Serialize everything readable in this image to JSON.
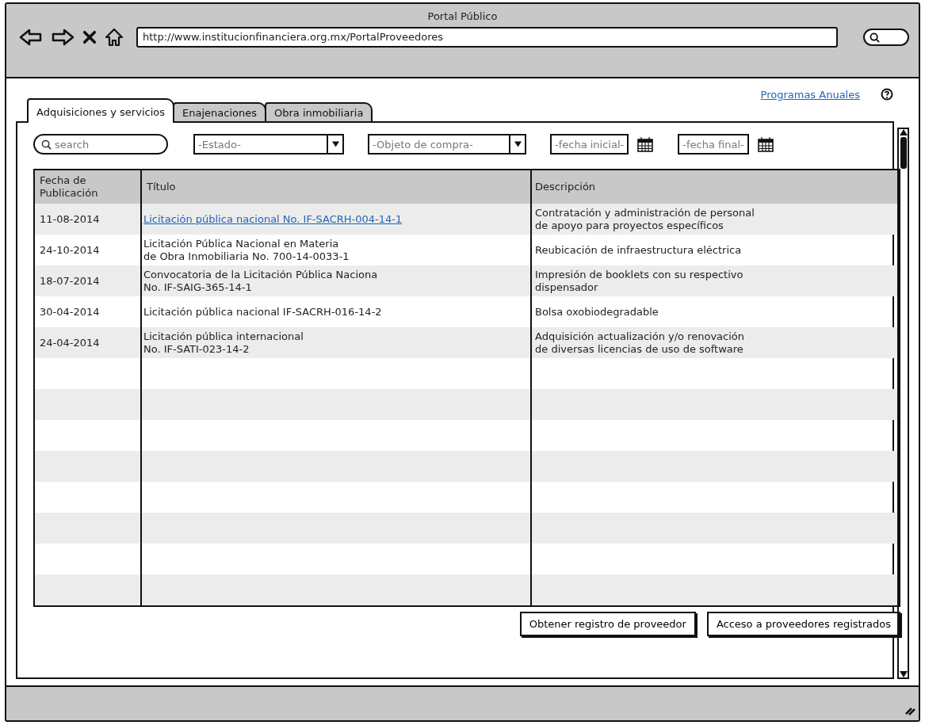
{
  "window": {
    "title": "Portal Público"
  },
  "browser": {
    "address": "http://www.institucionfinanciera.org.mx/PortalProveedores"
  },
  "tabs": [
    {
      "label": "Adquisiciones y servicios",
      "selected": true
    },
    {
      "label": "Enajenaciones",
      "selected": false
    },
    {
      "label": "Obra inmobiliaria",
      "selected": false
    }
  ],
  "top_link": "Programas Anuales",
  "filters": {
    "search": {
      "placeholder": "search"
    },
    "estado": {
      "placeholder": "-Estado-"
    },
    "objeto": {
      "placeholder": "-Objeto de compra-"
    },
    "fecha_inicial": {
      "placeholder": "-fecha inicial-"
    },
    "fecha_final": {
      "placeholder": "-fecha final-"
    }
  },
  "table": {
    "columns": [
      "Fecha de Publicación",
      "Título",
      "Descripción"
    ],
    "rows": [
      {
        "fecha": "11-08-2014",
        "titulo": "Licitación pública nacional No. IF-SACRH-004-14-1",
        "link": true,
        "descripcion": "Contratación y administración de personal\nde apoyo para proyectos específicos"
      },
      {
        "fecha": "24-10-2014",
        "titulo": "Licitación Pública Nacional en Materia\n de Obra Inmobiliaria No. 700-14-0033-1",
        "link": false,
        "descripcion": "Reubicación de infraestructura eléctrica"
      },
      {
        "fecha": "18-07-2014",
        "titulo": "Convocatoria de la Licitación Pública Naciona\nNo. IF-SAIG-365-14-1",
        "link": false,
        "descripcion": "Impresión de booklets con su respectivo\ndispensador"
      },
      {
        "fecha": "30-04-2014",
        "titulo": "Licitación pública nacional IF-SACRH-016-14-2",
        "link": false,
        "descripcion": "Bolsa oxobiodegradable"
      },
      {
        "fecha": "24-04-2014",
        "titulo": "Licitación pública internacional\nNo. IF-SATI-023-14-2",
        "link": false,
        "descripcion": "Adquisición actualización y/o renovación\nde diversas licencias de uso de software"
      }
    ]
  },
  "buttons": [
    "Obtener registro de proveedor",
    "Acceso a proveedores registrados"
  ]
}
